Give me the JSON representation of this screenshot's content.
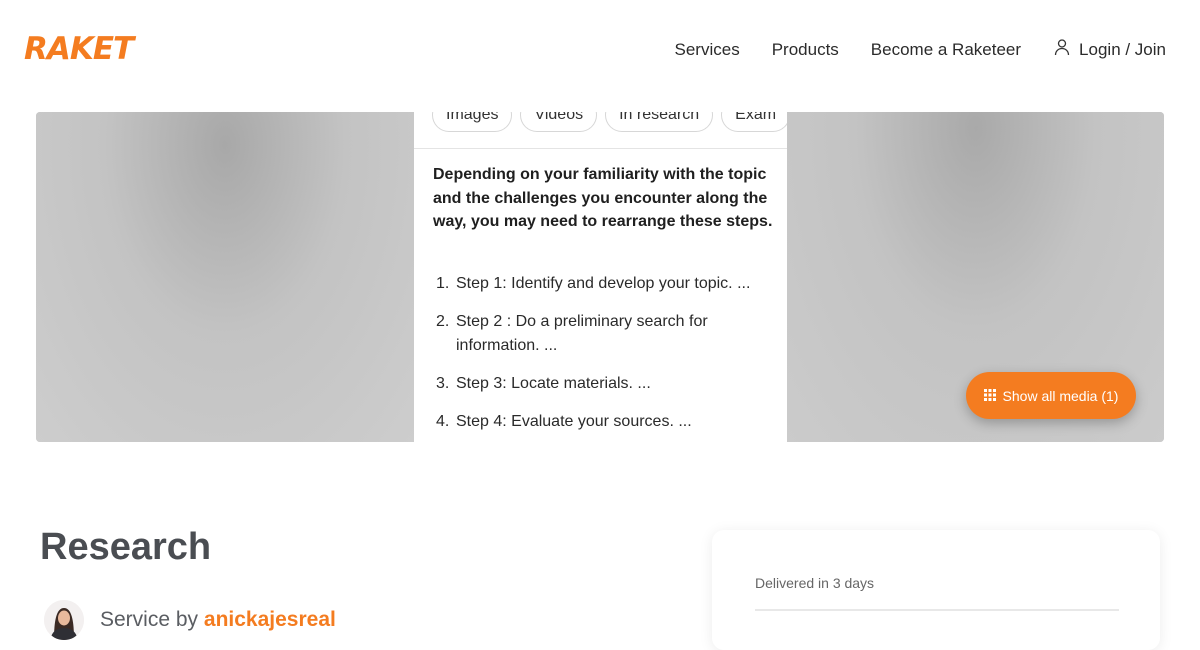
{
  "header": {
    "logo": "RAKET",
    "nav": {
      "services": "Services",
      "products": "Products",
      "become": "Become a Raketeer",
      "login": "Login / Join"
    }
  },
  "hero": {
    "chips": [
      "Images",
      "Videos",
      "In research",
      "Exam"
    ],
    "snippet": "Depending on your familiarity with the topic and the challenges you encounter along the way, you may need to rearrange these steps.",
    "steps": [
      {
        "num": "1.",
        "text": "Step 1: Identify and develop your topic. ..."
      },
      {
        "num": "2.",
        "text": "Step 2 : Do a preliminary search for information. ..."
      },
      {
        "num": "3.",
        "text": "Step 3: Locate materials. ..."
      },
      {
        "num": "4.",
        "text": "Step 4: Evaluate your sources. ..."
      }
    ],
    "show_media": "Show all media (1)"
  },
  "service": {
    "title": "Research",
    "by_prefix": "Service by",
    "username": "anickajesreal"
  },
  "card": {
    "delivered": "Delivered in 3 days"
  },
  "colors": {
    "brand": "#f47c20",
    "text": "#2b2b2b"
  }
}
